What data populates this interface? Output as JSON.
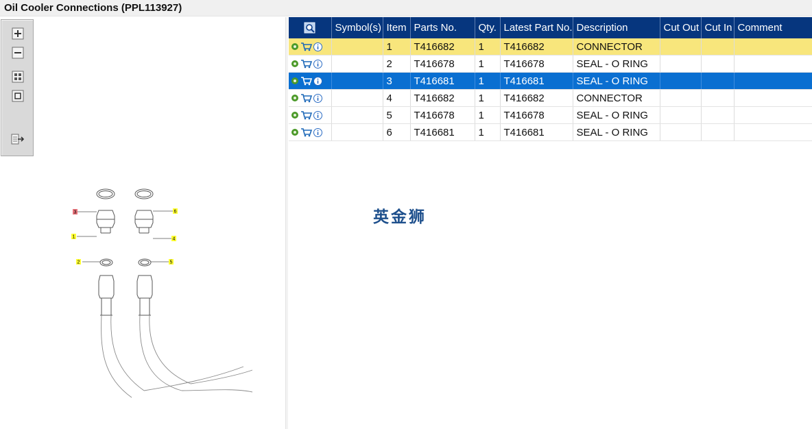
{
  "window": {
    "title": "Oil Cooler Connections (PPL113927)"
  },
  "toolbar": {
    "icons": [
      "zoom-in-icon",
      "zoom-out-icon",
      "fit-window-icon",
      "actual-size-icon",
      "export-icon"
    ]
  },
  "drawing": {
    "callouts": [
      {
        "label": "3",
        "color": "#e8737b"
      },
      {
        "label": "1",
        "color": "#ffff33"
      },
      {
        "label": "2",
        "color": "#ffff33"
      },
      {
        "label": "6",
        "color": "#ffff33"
      },
      {
        "label": "4",
        "color": "#ffff33"
      },
      {
        "label": "5",
        "color": "#ffff33"
      }
    ]
  },
  "table": {
    "columns": [
      "Symbol(s)",
      "Item",
      "Parts No.",
      "Qty.",
      "Latest Part No.",
      "Description",
      "Cut Out",
      "Cut In",
      "Comment"
    ],
    "rows": [
      {
        "item": "1",
        "part_no": "T416682",
        "qty": "1",
        "latest": "T416682",
        "desc": "CONNECTOR",
        "state": "highlight"
      },
      {
        "item": "2",
        "part_no": "T416678",
        "qty": "1",
        "latest": "T416678",
        "desc": "SEAL - O RING",
        "state": "normal"
      },
      {
        "item": "3",
        "part_no": "T416681",
        "qty": "1",
        "latest": "T416681",
        "desc": "SEAL - O RING",
        "state": "selected"
      },
      {
        "item": "4",
        "part_no": "T416682",
        "qty": "1",
        "latest": "T416682",
        "desc": "CONNECTOR",
        "state": "normal"
      },
      {
        "item": "5",
        "part_no": "T416678",
        "qty": "1",
        "latest": "T416678",
        "desc": "SEAL - O RING",
        "state": "normal"
      },
      {
        "item": "6",
        "part_no": "T416681",
        "qty": "1",
        "latest": "T416681",
        "desc": "SEAL - O RING",
        "state": "normal"
      }
    ]
  },
  "watermark": "英金狮",
  "colors": {
    "header": "#06367e",
    "highlight": "#f8e67c",
    "selected": "#0a6fd1"
  }
}
